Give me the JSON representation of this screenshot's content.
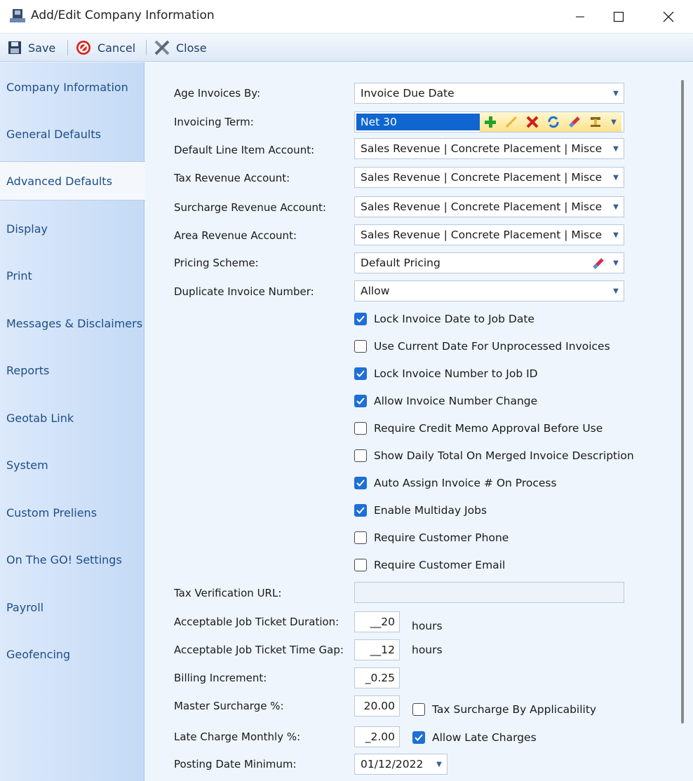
{
  "window": {
    "title": "Add/Edit Company Information"
  },
  "toolbar": {
    "save": "Save",
    "cancel": "Cancel",
    "close": "Close"
  },
  "sidebar": {
    "items": [
      "Company Information",
      "General Defaults",
      "Advanced Defaults",
      "Display",
      "Print",
      "Messages & Disclaimers",
      "Reports",
      "Geotab Link",
      "System",
      "Custom Preliens",
      "On The GO! Settings",
      "Payroll",
      "Geofencing"
    ],
    "active": "Advanced Defaults"
  },
  "form": {
    "age_invoices_by": {
      "label": "Age Invoices By:",
      "value": "Invoice Due Date"
    },
    "invoicing_term": {
      "label": "Invoicing Term:",
      "value": "Net 30"
    },
    "default_line_item_account": {
      "label": "Default Line Item Account:",
      "value": "Sales Revenue |  Concrete Placement |  Misce"
    },
    "tax_revenue_account": {
      "label": "Tax Revenue Account:",
      "value": "Sales Revenue |  Concrete Placement |  Misce"
    },
    "surcharge_revenue_account": {
      "label": "Surcharge Revenue Account:",
      "value": "Sales Revenue |  Concrete Placement |  Misce"
    },
    "area_revenue_account": {
      "label": "Area Revenue Account:",
      "value": "Sales Revenue |  Concrete Placement |  Misce"
    },
    "pricing_scheme": {
      "label": "Pricing Scheme:",
      "value": "Default Pricing"
    },
    "duplicate_invoice_number": {
      "label": "Duplicate Invoice Number:",
      "value": "Allow"
    },
    "checkboxes": [
      {
        "label": "Lock Invoice Date to Job Date",
        "checked": true
      },
      {
        "label": "Use Current Date For Unprocessed Invoices",
        "checked": false
      },
      {
        "label": "Lock Invoice Number to Job ID",
        "checked": true
      },
      {
        "label": "Allow Invoice Number Change",
        "checked": true
      },
      {
        "label": "Require Credit Memo Approval Before Use",
        "checked": false
      },
      {
        "label": "Show Daily Total On Merged Invoice Description",
        "checked": false
      },
      {
        "label": "Auto Assign Invoice # On Process",
        "checked": true
      },
      {
        "label": "Enable Multiday Jobs",
        "checked": true
      },
      {
        "label": "Require Customer Phone",
        "checked": false
      },
      {
        "label": "Require Customer Email",
        "checked": false
      }
    ],
    "tax_verification_url": {
      "label": "Tax Verification URL:",
      "value": ""
    },
    "acceptable_job_ticket_duration": {
      "label": "Acceptable Job Ticket Duration:",
      "value": "__20",
      "unit": "hours"
    },
    "acceptable_job_ticket_time_gap": {
      "label": "Acceptable Job Ticket Time Gap:",
      "value": "__12",
      "unit": "hours"
    },
    "billing_increment": {
      "label": "Billing Increment:",
      "value": "_0.25"
    },
    "master_surcharge": {
      "label": "Master Surcharge %:",
      "value": "20.00",
      "option": {
        "label": "Tax Surcharge By Applicability",
        "checked": false
      }
    },
    "late_charge_monthly": {
      "label": "Late Charge Monthly %:",
      "value": "_2.00",
      "option": {
        "label": "Allow Late Charges",
        "checked": true
      }
    },
    "posting_date_minimum": {
      "label": "Posting Date Minimum:",
      "value": "01/12/2022"
    }
  },
  "colors": {
    "accent": "#1f6fd6",
    "sidebar_text": "#1e4e86",
    "selection": "#0f66d0"
  }
}
